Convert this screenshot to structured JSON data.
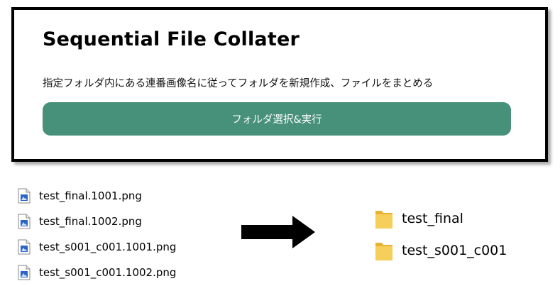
{
  "app": {
    "title": "Sequential File Collater",
    "description": "指定フォルダ内にある連番画像名に従ってフォルダを新規作成、ファイルをまとめる",
    "button_label": "フォルダ選択&実行",
    "accent_color": "#479079"
  },
  "files": [
    {
      "name": "test_final.1001.png",
      "icon": "image-file-icon"
    },
    {
      "name": "test_final.1002.png",
      "icon": "image-file-icon"
    },
    {
      "name": "test_s001_c001.1001.png",
      "icon": "image-file-icon"
    },
    {
      "name": "test_s001_c001.1002.png",
      "icon": "image-file-icon"
    }
  ],
  "arrow": {
    "icon": "arrow-right-icon"
  },
  "folders": [
    {
      "name": "test_final",
      "icon": "folder-icon"
    },
    {
      "name": "test_s001_c001",
      "icon": "folder-icon"
    }
  ]
}
